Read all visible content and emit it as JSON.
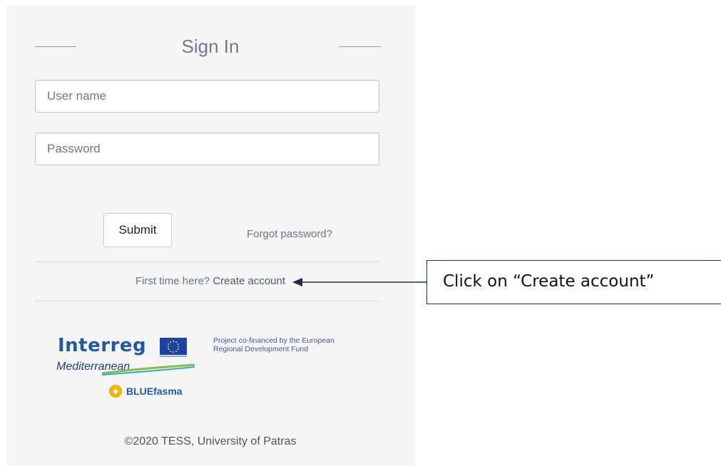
{
  "signin": {
    "title": "Sign In",
    "username_placeholder": "User name",
    "password_placeholder": "Password",
    "submit_label": "Submit",
    "forgot_label": "Forgot password?",
    "first_time_text": "First time here?",
    "create_label": "Create account"
  },
  "branding": {
    "interreg": "Interreg",
    "mediterranean": "Mediterranean",
    "bluefasma": "BLUEfasma",
    "cofund_line1": "Project co-financed by the European",
    "cofund_line2": "Regional Development Fund",
    "copyright": "©2020 TESS, University of Patras"
  },
  "annotation": {
    "callout_text": "Click on “Create account”"
  },
  "colors": {
    "panel_bg": "#f5f5f5",
    "title": "#6f7b8a",
    "link": "#6b7684",
    "brand_blue": "#1f5aa6",
    "callout_border": "#1e2c58",
    "bluefasma_yellow": "#f3b400"
  }
}
